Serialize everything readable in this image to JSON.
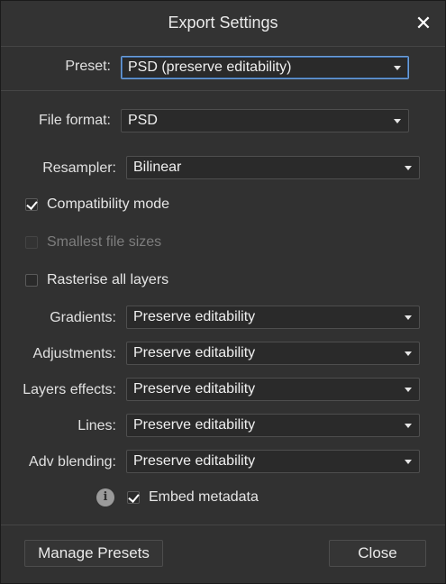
{
  "window": {
    "title": "Export Settings",
    "close_glyph": "✕"
  },
  "preset": {
    "label": "Preset:",
    "value": "PSD (preserve editability)"
  },
  "file_format": {
    "label": "File format:",
    "value": "PSD"
  },
  "resampler": {
    "label": "Resampler:",
    "value": "Bilinear"
  },
  "checkboxes": {
    "compatibility": {
      "label": "Compatibility mode",
      "checked": true
    },
    "smallest": {
      "label": "Smallest file sizes",
      "checked": false,
      "disabled": true
    },
    "rasterise": {
      "label": "Rasterise all layers",
      "checked": false
    }
  },
  "options": [
    {
      "label": "Gradients:",
      "value": "Preserve editability"
    },
    {
      "label": "Adjustments:",
      "value": "Preserve editability"
    },
    {
      "label": "Layers effects:",
      "value": "Preserve editability"
    },
    {
      "label": "Lines:",
      "value": "Preserve editability"
    },
    {
      "label": "Adv blending:",
      "value": "Preserve editability"
    }
  ],
  "metadata": {
    "info_glyph": "i",
    "label": "Embed metadata",
    "checked": true
  },
  "buttons": {
    "manage": "Manage Presets",
    "close": "Close"
  },
  "colors": {
    "background": "#313131",
    "field": "#2a2a2a",
    "focus_border": "#6e9dd6"
  },
  "icons": {
    "close": "close-icon",
    "info": "info-icon",
    "check": "checkmark-icon",
    "dropdown": "chevron-down-icon"
  }
}
